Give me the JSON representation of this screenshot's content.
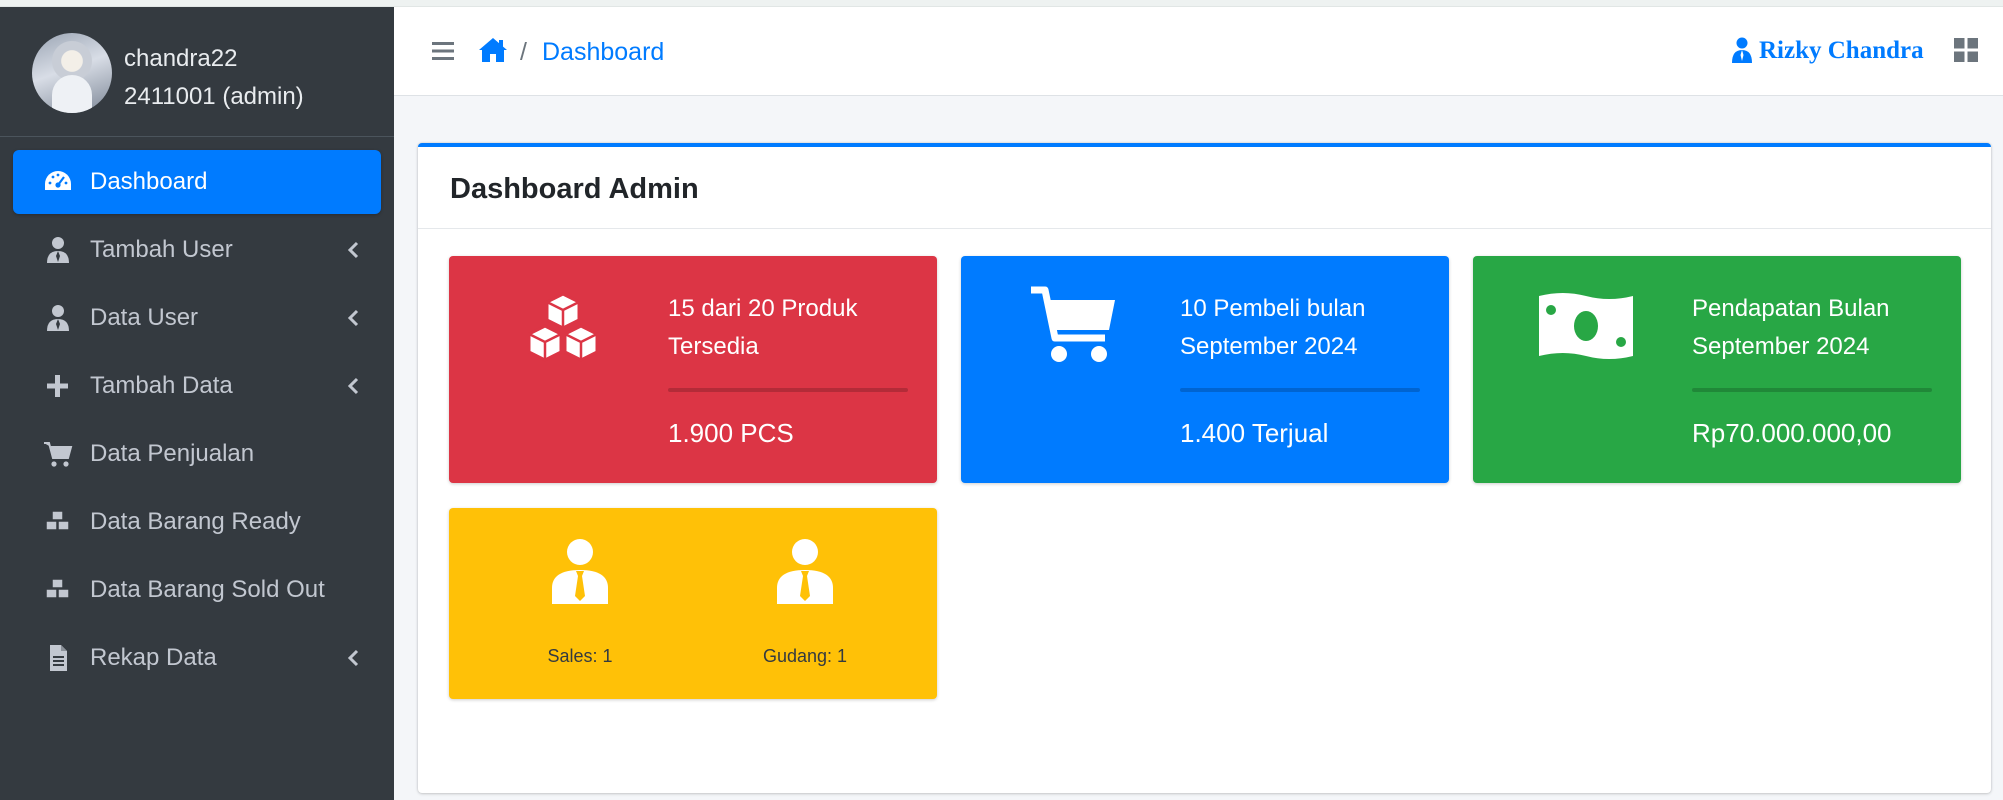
{
  "sidebar": {
    "user": {
      "name": "chandra22",
      "id_role": "2411001 (admin)"
    },
    "items": [
      {
        "label": "Dashboard",
        "icon": "tachometer-icon",
        "active": true
      },
      {
        "label": "Tambah User",
        "icon": "user-icon",
        "has_chevron": true
      },
      {
        "label": "Data User",
        "icon": "user-icon",
        "has_chevron": true
      },
      {
        "label": "Tambah Data",
        "icon": "plus-icon",
        "has_chevron": true
      },
      {
        "label": "Data Penjualan",
        "icon": "cart-icon"
      },
      {
        "label": "Data Barang Ready",
        "icon": "cubes-icon"
      },
      {
        "label": "Data Barang Sold Out",
        "icon": "cubes-icon"
      },
      {
        "label": "Rekap Data",
        "icon": "file-icon",
        "has_chevron": true
      }
    ]
  },
  "header": {
    "breadcrumb_separator": "/",
    "breadcrumb_current": "Dashboard",
    "user_name": "Rizky Chandra"
  },
  "card": {
    "title": "Dashboard Admin",
    "boxes": [
      {
        "title": "15 dari 20 Produk Tersedia",
        "value": "1.900 PCS",
        "color": "#dc3545",
        "icon": "cubes-icon"
      },
      {
        "title": "10 Pembeli bulan September 2024",
        "value": "1.400 Terjual",
        "color": "#007bff",
        "icon": "cart-icon"
      },
      {
        "title": "Pendapatan Bulan September 2024",
        "value": "Rp70.000.000,00",
        "color": "#28a745",
        "icon": "money-bill-icon"
      }
    ],
    "staff": {
      "color": "#ffc107",
      "sales": "Sales: 1",
      "gudang": "Gudang: 1"
    }
  },
  "colors": {
    "primary": "#007bff",
    "sidebar_bg": "#343a40",
    "sidebar_text": "#c2c7d0"
  }
}
